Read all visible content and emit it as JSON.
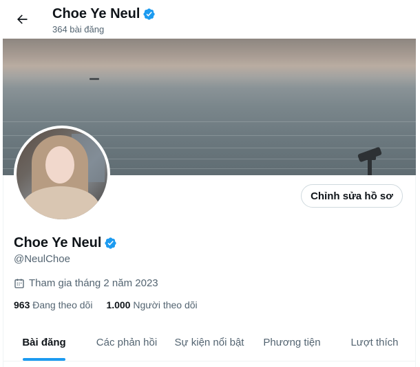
{
  "header": {
    "name": "Choe Ye Neul",
    "post_count": "364 bài đăng",
    "back_icon": "arrow-left-icon"
  },
  "profile": {
    "name": "Choe Ye Neul",
    "handle": "@NeulChoe",
    "joined": "Tham gia tháng 2 năm 2023",
    "edit_label": "Chỉnh sửa hồ sơ",
    "following_count": "963",
    "following_label": "Đang theo dõi",
    "followers_count": "1.000",
    "followers_label": "Người theo dõi",
    "verified_color": "#1d9bf0"
  },
  "tabs": [
    {
      "label": "Bài đăng",
      "active": true
    },
    {
      "label": "Các phản hồi",
      "active": false
    },
    {
      "label": "Sự kiện nổi bật",
      "active": false
    },
    {
      "label": "Phương tiện",
      "active": false
    },
    {
      "label": "Lượt thích",
      "active": false
    }
  ],
  "colors": {
    "accent": "#1d9bf0",
    "text": "#0f1419",
    "muted": "#536471"
  }
}
